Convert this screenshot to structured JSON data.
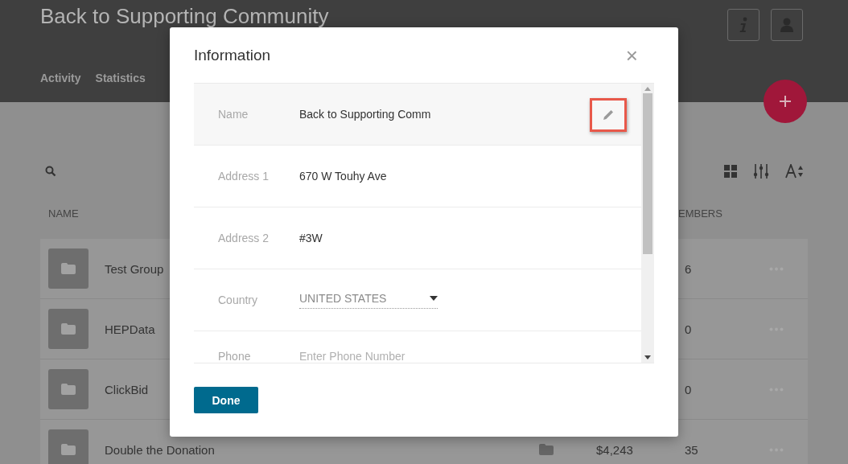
{
  "page": {
    "title": "Back to Supporting Community",
    "tabs": [
      {
        "label": "Activity",
        "selected": false
      },
      {
        "label": "Statistics",
        "selected": false
      }
    ],
    "columns": [
      "NAME",
      "EMBERS"
    ],
    "rows": [
      {
        "name": "Test Group",
        "members": "6"
      },
      {
        "name": "HEPData",
        "members": "0"
      },
      {
        "name": "ClickBid",
        "members": "0"
      },
      {
        "name": "Double the Donation",
        "amount": "$4,243",
        "members": "35"
      }
    ]
  },
  "dialog": {
    "title": "Information",
    "close": "×",
    "fields": [
      {
        "kind": "text",
        "label": "Name",
        "value": "Back to Supporting Comm",
        "highlighted": true
      },
      {
        "kind": "text",
        "label": "Address 1",
        "value": "670 W Touhy Ave",
        "highlighted": false
      },
      {
        "kind": "text",
        "label": "Address 2",
        "value": "#3W",
        "highlighted": false
      },
      {
        "kind": "select",
        "label": "Country",
        "value": "UNITED STATES",
        "highlighted": false
      },
      {
        "kind": "input",
        "label": "Phone",
        "placeholder": "Enter Phone Number",
        "highlighted": false
      }
    ],
    "done": "Done"
  }
}
